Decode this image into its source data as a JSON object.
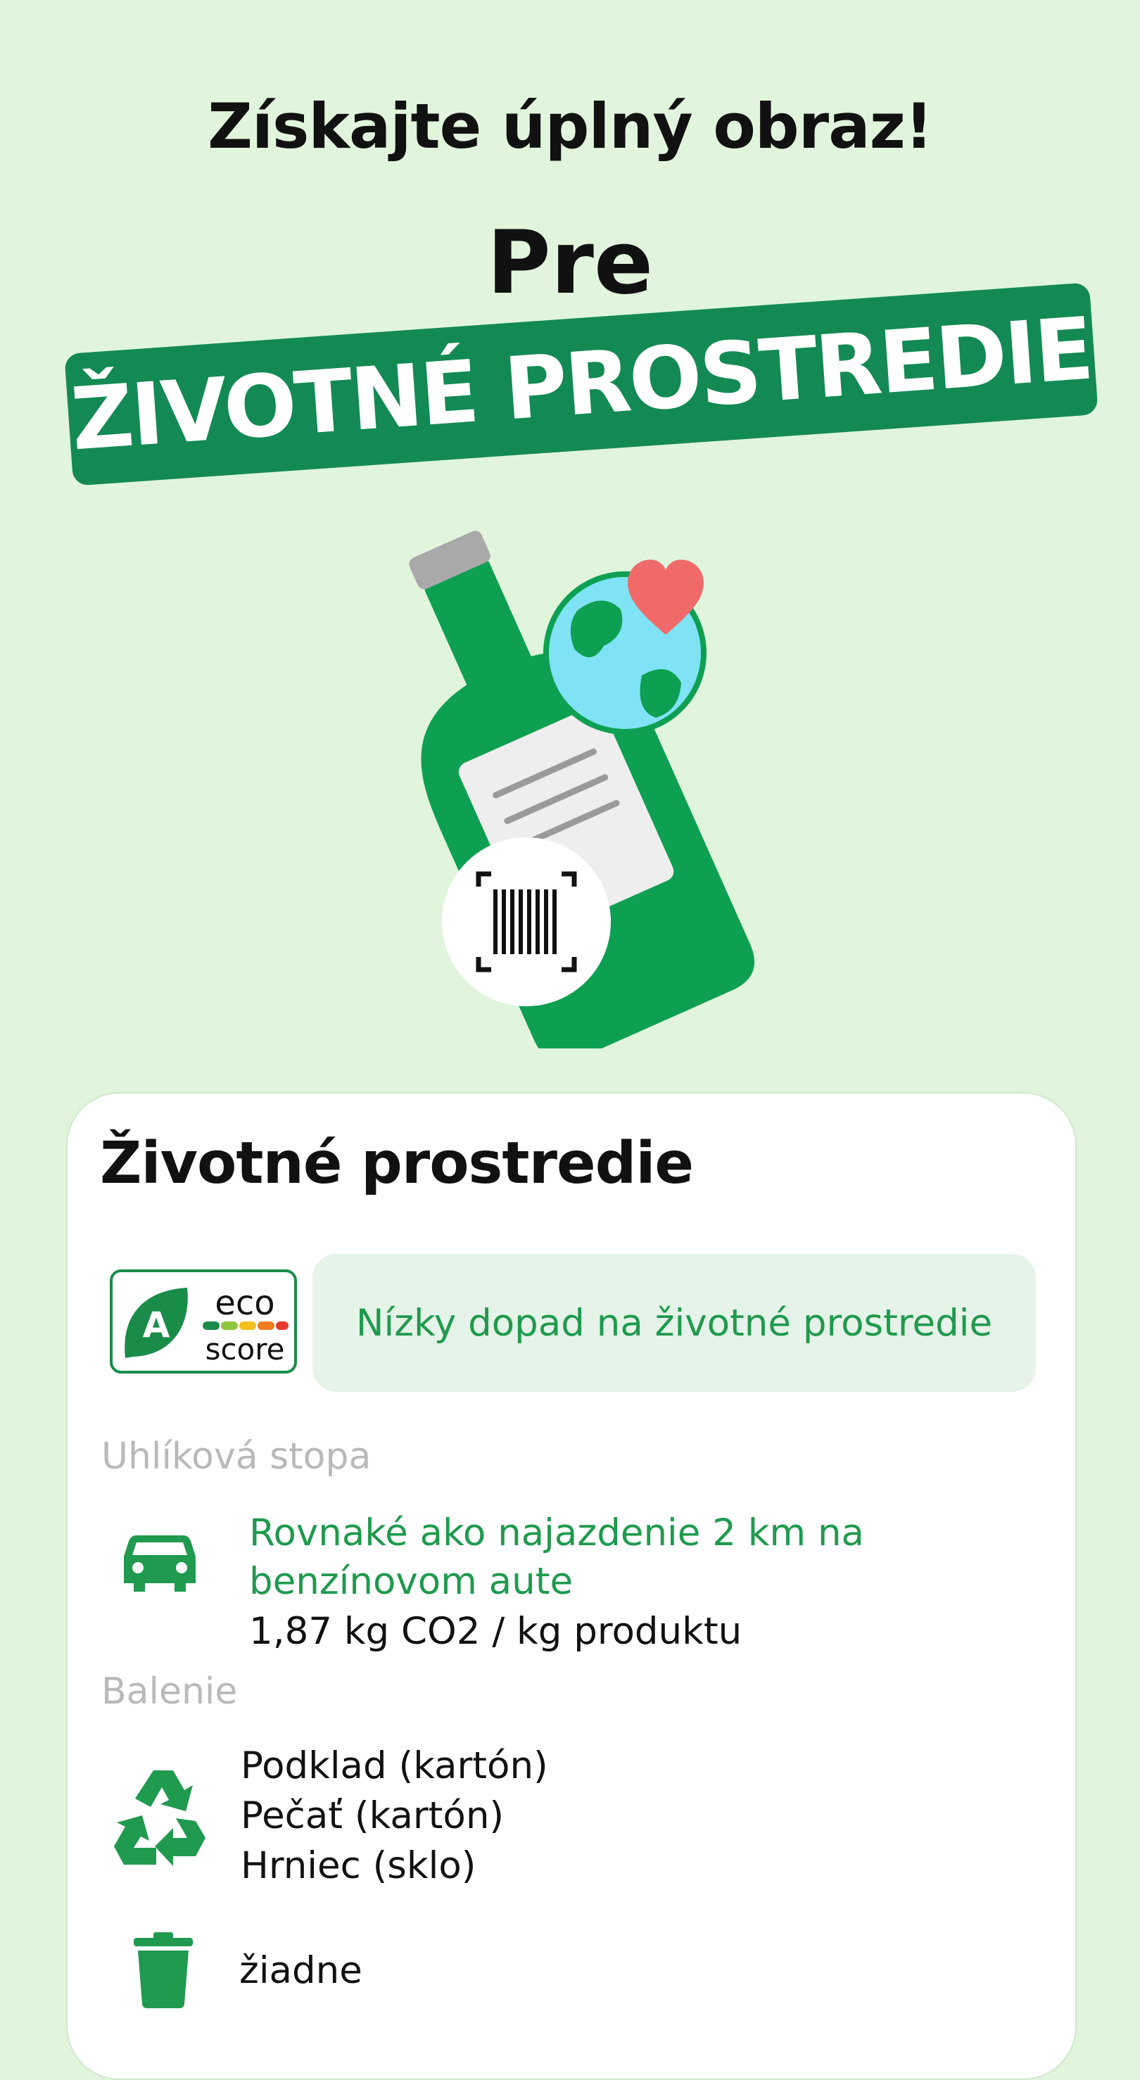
{
  "header": {
    "headline": "Získajte úplný obraz!",
    "pre": "Pre",
    "banner": "ŽIVOTNÉ PROSTREDIE"
  },
  "colors": {
    "background": "#e1f5dc",
    "brand_green": "#138a53",
    "accent_green": "#1f9a4e",
    "pill_bg": "#e6f3e8",
    "muted_label": "#b9b9b9"
  },
  "illustration": {
    "icons": [
      "bottle-icon",
      "earth-icon",
      "heart-icon",
      "barcode-scan-icon"
    ]
  },
  "card": {
    "title": "Životné prostredie",
    "eco_score": {
      "grade": "A",
      "word1": "eco",
      "word2": "score",
      "impact_text": "Nízky dopad na životné prostredie"
    },
    "carbon": {
      "label": "Uhlíková stopa",
      "line1": "Rovnaké ako najazdenie 2 km na",
      "line2": "benzínovom aute",
      "value": "1,87 kg CO2 / kg produktu",
      "icon": "car-icon"
    },
    "packaging": {
      "label": "Balenie",
      "items": [
        "Podklad (kartón)",
        "Pečať (kartón)",
        "Hrniec (sklo)"
      ],
      "icon": "recycle-icon",
      "trash_text": "žiadne",
      "trash_icon": "trash-icon"
    }
  }
}
